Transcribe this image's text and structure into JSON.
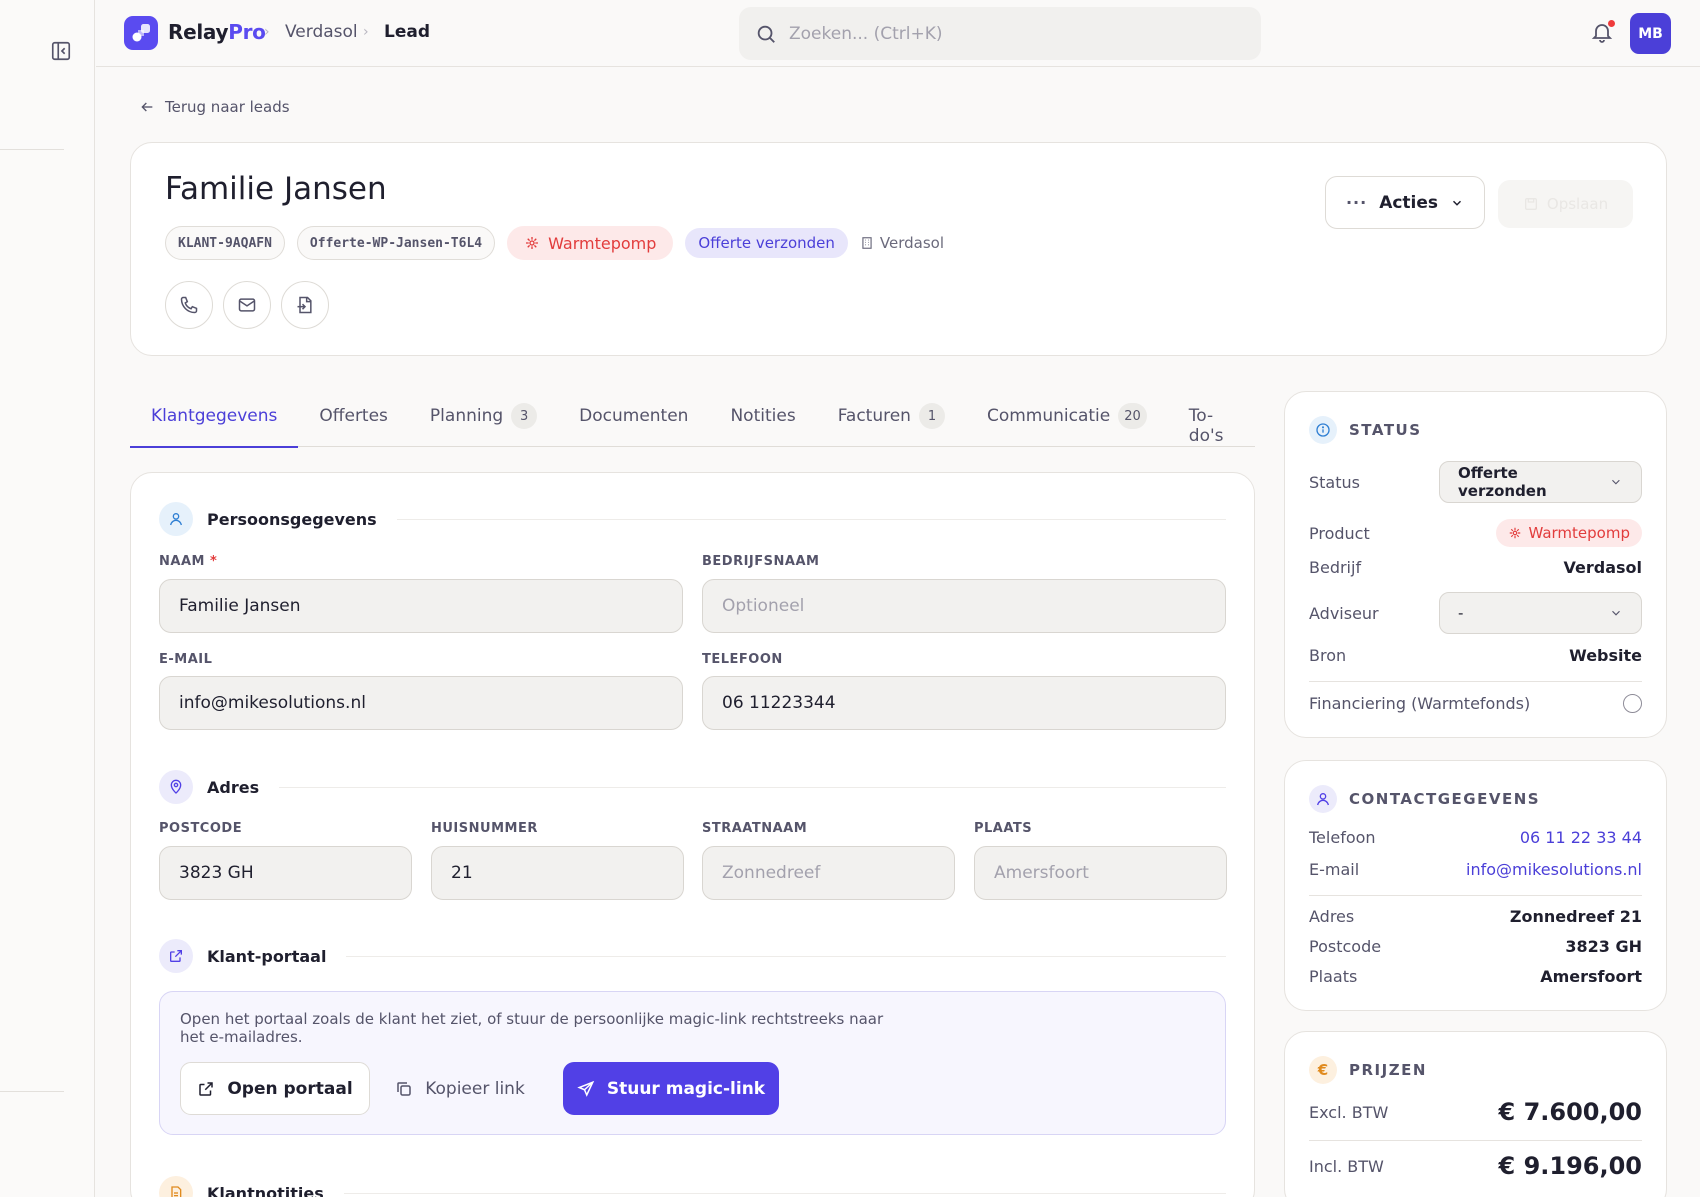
{
  "app": {
    "brand_main": "Relay",
    "brand_accent": "Pro",
    "accent_color": "#5140e6"
  },
  "breadcrumb": {
    "company": "Verdasol",
    "current": "Lead"
  },
  "search": {
    "placeholder": "Zoeken... (Ctrl+K)"
  },
  "user": {
    "initials": "MB"
  },
  "back": {
    "label": "Terug naar leads"
  },
  "lead": {
    "name": "Familie Jansen",
    "customer_id": "KLANT-9AQAFN",
    "quote_id": "Offerte-WP-Jansen-T6L4",
    "product": "Warmtepomp",
    "status": "Offerte verzonden",
    "company": "Verdasol"
  },
  "header_actions": {
    "acties": "Acties",
    "opslaan": "Opslaan"
  },
  "tabs": [
    {
      "label": "Klantgegevens",
      "count": ""
    },
    {
      "label": "Offertes",
      "count": ""
    },
    {
      "label": "Planning",
      "count": "3"
    },
    {
      "label": "Documenten",
      "count": ""
    },
    {
      "label": "Notities",
      "count": ""
    },
    {
      "label": "Facturen",
      "count": "1"
    },
    {
      "label": "Communicatie",
      "count": "20"
    },
    {
      "label": "To-do's",
      "count": ""
    }
  ],
  "persons": {
    "title": "Persoonsgegevens",
    "name_label": "NAAM",
    "name_required": "*",
    "name_value": "Familie Jansen",
    "company_label": "BEDRIJFSNAAM",
    "company_placeholder": "Optioneel",
    "email_label": "E-MAIL",
    "email_value": "info@mikesolutions.nl",
    "phone_label": "TELEFOON",
    "phone_value": "06 11223344"
  },
  "address": {
    "title": "Adres",
    "postcode_label": "POSTCODE",
    "postcode_value": "3823 GH",
    "number_label": "HUISNUMMER",
    "number_value": "21",
    "street_label": "STRAATNAAM",
    "street_placeholder": "Zonnedreef",
    "city_label": "PLAATS",
    "city_placeholder": "Amersfoort"
  },
  "portal": {
    "title": "Klant-portaal",
    "description": "Open het portaal zoals de klant het ziet, of stuur de persoonlijke magic-link rechtstreeks naar het e-mailadres.",
    "open_label": "Open portaal",
    "copy_label": "Kopieer link",
    "send_label": "Stuur magic-link"
  },
  "notes": {
    "title": "Klantnotities"
  },
  "status_card": {
    "title": "STATUS",
    "status_label": "Status",
    "status_value": "Offerte verzonden",
    "product_label": "Product",
    "product_value": "Warmtepomp",
    "company_label": "Bedrijf",
    "company_value": "Verdasol",
    "advisor_label": "Adviseur",
    "advisor_value": "-",
    "source_label": "Bron",
    "source_value": "Website",
    "financing_label": "Financiering (Warmtefonds)"
  },
  "contact_card": {
    "title": "CONTACTGEGEVENS",
    "phone_label": "Telefoon",
    "phone_value": "06 11 22 33 44",
    "email_label": "E-mail",
    "email_value": "info@mikesolutions.nl",
    "address_label": "Adres",
    "address_value": "Zonnedreef 21",
    "postcode_label": "Postcode",
    "postcode_value": "3823 GH",
    "city_label": "Plaats",
    "city_value": "Amersfoort"
  },
  "prices_card": {
    "title": "PRIJZEN",
    "excl_label": "Excl. BTW",
    "excl_value": "€ 7.600,00",
    "incl_label": "Incl. BTW",
    "incl_value": "€ 9.196,00"
  }
}
